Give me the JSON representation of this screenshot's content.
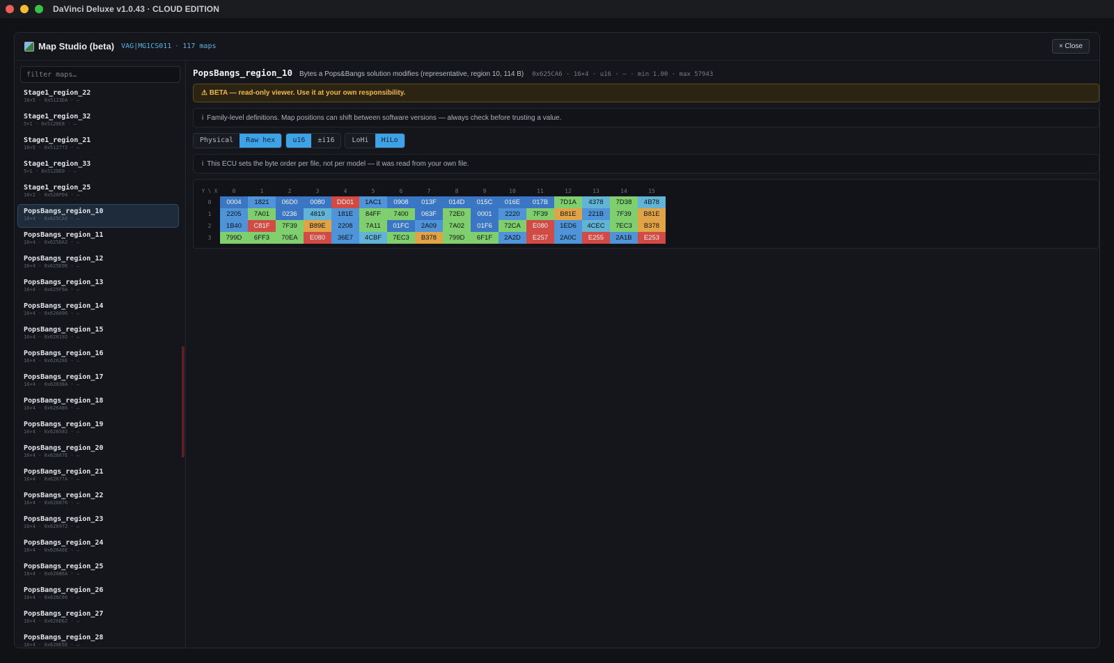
{
  "window": {
    "title": "DaVinci Deluxe v1.0.43 · CLOUD EDITION"
  },
  "studio": {
    "title": "Map Studio (beta)",
    "ecu": "VAG|MG1CS011",
    "map_count": "117 maps",
    "close_label": "× Close"
  },
  "sidebar": {
    "filter_placeholder": "filter maps…",
    "items": [
      {
        "name": "Stage1_region_22",
        "sub": "16×5 · 0x5123DA · —"
      },
      {
        "name": "Stage1_region_32",
        "sub": "5×1 · 0x5126E8 · —"
      },
      {
        "name": "Stage1_region_21",
        "sub": "16×5 · 0x512772 · —"
      },
      {
        "name": "Stage1_region_33",
        "sub": "5×1 · 0x512DE0 · —"
      },
      {
        "name": "Stage1_region_25",
        "sub": "16×2 · 0x526FD4 · —"
      },
      {
        "name": "PopsBangs_region_10",
        "sub": "16×4 · 0x625CA6 · —"
      },
      {
        "name": "PopsBangs_region_11",
        "sub": "16×4 · 0x625DA2 · —"
      },
      {
        "name": "PopsBangs_region_12",
        "sub": "16×4 · 0x625E9E · —"
      },
      {
        "name": "PopsBangs_region_13",
        "sub": "16×4 · 0x625F9A · —"
      },
      {
        "name": "PopsBangs_region_14",
        "sub": "16×4 · 0x626096 · —"
      },
      {
        "name": "PopsBangs_region_15",
        "sub": "16×4 · 0x626192 · —"
      },
      {
        "name": "PopsBangs_region_16",
        "sub": "16×4 · 0x62628E · —"
      },
      {
        "name": "PopsBangs_region_17",
        "sub": "16×4 · 0x62638A · —"
      },
      {
        "name": "PopsBangs_region_18",
        "sub": "16×4 · 0x626486 · —"
      },
      {
        "name": "PopsBangs_region_19",
        "sub": "16×4 · 0x626582 · —"
      },
      {
        "name": "PopsBangs_region_20",
        "sub": "16×4 · 0x62667E · —"
      },
      {
        "name": "PopsBangs_region_21",
        "sub": "16×4 · 0x62677A · —"
      },
      {
        "name": "PopsBangs_region_22",
        "sub": "16×4 · 0x626876 · —"
      },
      {
        "name": "PopsBangs_region_23",
        "sub": "16×4 · 0x626972 · —"
      },
      {
        "name": "PopsBangs_region_24",
        "sub": "16×4 · 0x626A6E · —"
      },
      {
        "name": "PopsBangs_region_25",
        "sub": "16×4 · 0x626B6A · —"
      },
      {
        "name": "PopsBangs_region_26",
        "sub": "16×4 · 0x626C66 · —"
      },
      {
        "name": "PopsBangs_region_27",
        "sub": "16×4 · 0x626D62 · —"
      },
      {
        "name": "PopsBangs_region_28",
        "sub": "16×4 · 0x626E5E · —"
      }
    ],
    "selected_index": 5
  },
  "map": {
    "title": "PopsBangs_region_10",
    "description": "Bytes a Pops&Bangs solution modifies (representative, region 10, 114 B)",
    "facts": "0x625CA6 · 16×4 · u16 · – · min 1.00 · max 57943",
    "beta_banner": "⚠ BETA — read-only viewer. Use it at your own responsibility.",
    "info_family": "Family-level definitions. Map positions can shift between software versions — always check before trusting a value.",
    "info_byteorder": "This ECU sets the byte order per file, not per model — it was read from your own file.",
    "info_icon": "i"
  },
  "toggles": {
    "groups": [
      [
        {
          "label": "Physical",
          "active": false
        },
        {
          "label": "Raw hex",
          "active": true
        }
      ],
      [
        {
          "label": "u16",
          "active": true
        },
        {
          "label": "±i16",
          "active": false
        }
      ],
      [
        {
          "label": "LoHi",
          "active": false
        },
        {
          "label": "HiLo",
          "active": true
        }
      ]
    ]
  },
  "grid": {
    "corner": "Y \\ X",
    "x_headers": [
      "0",
      "1",
      "2",
      "3",
      "4",
      "5",
      "6",
      "7",
      "8",
      "9",
      "10",
      "11",
      "12",
      "13",
      "14",
      "15"
    ],
    "y_headers": [
      "0",
      "1",
      "2",
      "3"
    ],
    "rows": [
      [
        "0004",
        "1821",
        "06D0",
        "0080",
        "DD01",
        "1AC1",
        "0908",
        "013F",
        "014D",
        "015C",
        "016E",
        "017B",
        "7D1A",
        "4378",
        "7D38",
        "4B78"
      ],
      [
        "2205",
        "7A01",
        "0236",
        "4819",
        "181E",
        "84FF",
        "7400",
        "063F",
        "72E0",
        "0001",
        "2220",
        "7F39",
        "B81E",
        "221B",
        "7F39",
        "B81E"
      ],
      [
        "1B40",
        "C81F",
        "7F39",
        "B89E",
        "2208",
        "7A11",
        "01FC",
        "2A09",
        "7A02",
        "01F6",
        "72CA",
        "E080",
        "1ED6",
        "4CEC",
        "7EC3",
        "B378"
      ],
      [
        "799D",
        "6FF3",
        "70EA",
        "E080",
        "36E7",
        "4CBF",
        "7EC3",
        "B378",
        "799D",
        "6F1F",
        "2A2D",
        "E257",
        "2A0C",
        "E255",
        "2A1B",
        "E253"
      ]
    ]
  },
  "colors": {
    "accent": "#3ea2e6",
    "heat_low": "#3a76c4",
    "heat_mid": "#7fcf6e",
    "heat_high": "#e0a447",
    "heat_max": "#d24a44"
  }
}
